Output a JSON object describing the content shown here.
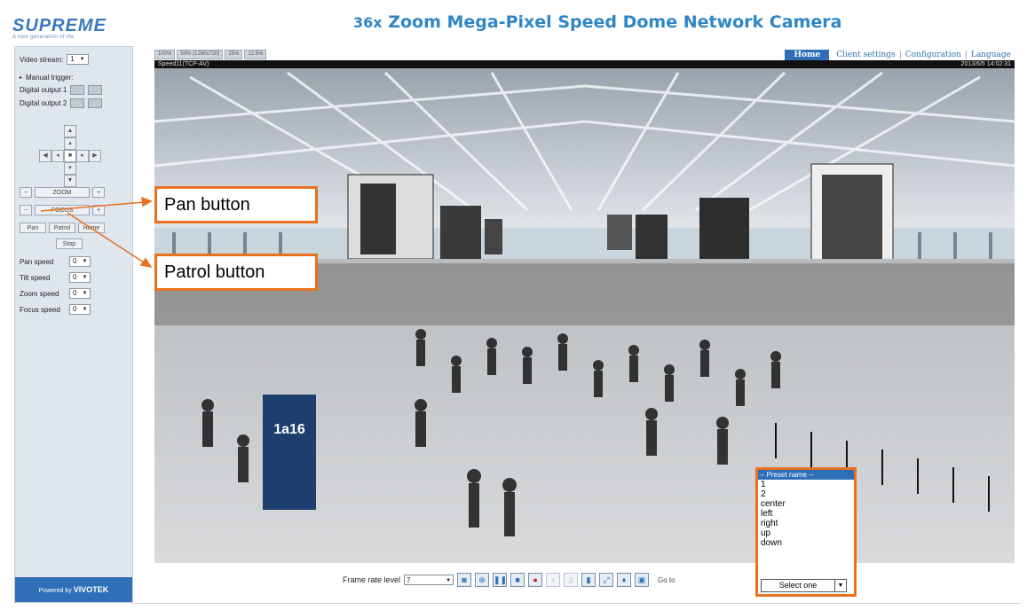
{
  "brand": {
    "logo": "SUPREME",
    "tagline": "A new generation of life",
    "powered_by": "Powered by ",
    "powered_brand": "VIVOTEK"
  },
  "page_title": {
    "zoom": "36x",
    "text": " Zoom Mega-Pixel Speed Dome Network Camera"
  },
  "nav": {
    "home": "Home",
    "client_settings": "Client settings",
    "configuration": "Configuration",
    "language": "Language"
  },
  "size_tabs": [
    "100%",
    "50% (1280x720)",
    "25%",
    "12.5%"
  ],
  "left_panel": {
    "video_stream_label": "Video stream:",
    "video_stream_value": "1",
    "manual_trigger": "Manual trigger:",
    "digital_output_1": "Digital output 1",
    "digital_output_2": "Digital output 2",
    "zoom_label": "ZOOM",
    "focus_label": "FOCUS",
    "pan_button": "Pan",
    "patrol_button": "Patrol",
    "home_button": "Home",
    "stop_button": "Stop",
    "speeds": [
      {
        "label": "Pan speed",
        "value": "0"
      },
      {
        "label": "Tilt speed",
        "value": "0"
      },
      {
        "label": "Zoom speed",
        "value": "0"
      },
      {
        "label": "Focus speed",
        "value": "0"
      }
    ]
  },
  "video": {
    "caption_left": "Speed11(TCP-AV)",
    "caption_right": "2013/6/5 14:02:31"
  },
  "callouts": {
    "pan": "Pan button",
    "patrol": "Patrol button"
  },
  "preset_dropdown": {
    "header": "-- Preset name --",
    "options": [
      "1",
      "2",
      "center",
      "left",
      "right",
      "up",
      "down"
    ],
    "selected": "Select one"
  },
  "toolbar": {
    "frame_rate_label": "Frame rate level",
    "frame_rate_value": "7",
    "goto_label": "Go to"
  },
  "colors": {
    "accent": "#e8701e",
    "brand_blue": "#2e6fb8",
    "title_blue": "#2f86c7",
    "panel_bg": "#dfe6ee"
  }
}
